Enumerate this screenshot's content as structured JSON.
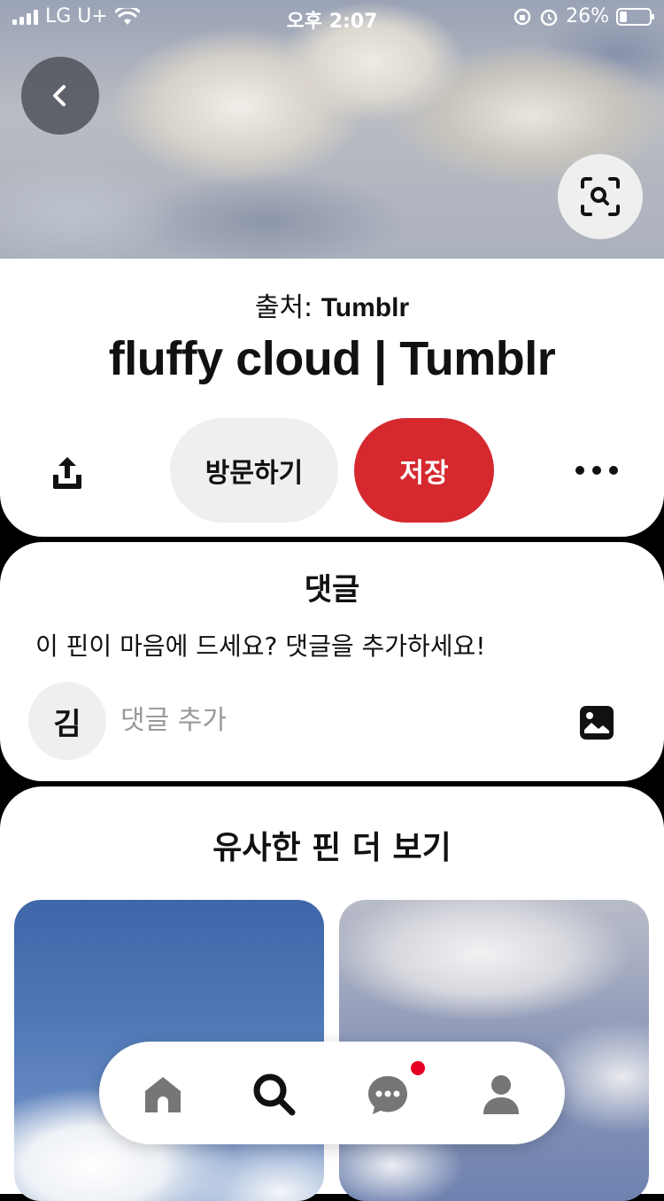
{
  "status_bar": {
    "carrier": "LG U+",
    "time": "오후 2:07",
    "battery": "26%"
  },
  "pin": {
    "source_prefix": "출처:",
    "source_name": "Tumblr",
    "title": "fluffy cloud | Tumblr",
    "visit_label": "방문하기",
    "save_label": "저장"
  },
  "comments": {
    "title": "댓글",
    "prompt": "이 핀이 마음에 드세요? 댓글을 추가하세요!",
    "avatar_initial": "김",
    "input_placeholder": "댓글 추가"
  },
  "similar": {
    "title": "유사한 핀 더 보기"
  },
  "colors": {
    "save_red": "#d6292f",
    "badge_red": "#e60023",
    "pill_gray": "#efefef"
  },
  "icons": [
    "back-icon",
    "visual-search-icon",
    "share-icon",
    "more-icon",
    "image-icon",
    "home-icon",
    "search-icon",
    "messages-icon",
    "profile-icon"
  ]
}
